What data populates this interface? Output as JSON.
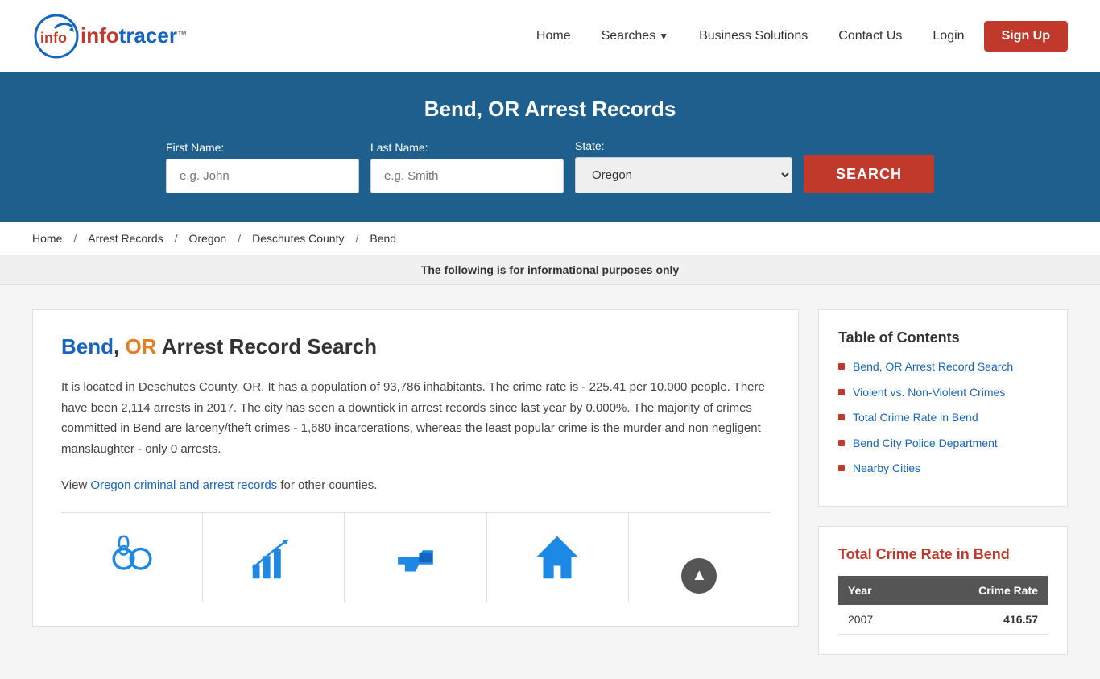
{
  "header": {
    "logo_text_red": "info",
    "logo_text_blue": "tracer",
    "logo_tm": "™",
    "nav": {
      "home": "Home",
      "searches": "Searches",
      "business_solutions": "Business Solutions",
      "contact_us": "Contact Us",
      "login": "Login",
      "signup": "Sign Up"
    }
  },
  "hero": {
    "title": "Bend, OR Arrest Records",
    "form": {
      "first_name_label": "First Name:",
      "first_name_placeholder": "e.g. John",
      "last_name_label": "Last Name:",
      "last_name_placeholder": "e.g. Smith",
      "state_label": "State:",
      "state_value": "Oregon",
      "search_button": "SEARCH"
    }
  },
  "breadcrumb": {
    "home": "Home",
    "arrest_records": "Arrest Records",
    "oregon": "Oregon",
    "deschutes_county": "Deschutes County",
    "bend": "Bend"
  },
  "info_bar": {
    "text": "The following is for informational purposes only"
  },
  "content": {
    "title_blue1": "Bend",
    "title_comma": ",",
    "title_orange": " OR",
    "title_rest": " Arrest Record Search",
    "body_text": "It is located in Deschutes County, OR. It has a population of 93,786 inhabitants. The crime rate is - 225.41 per 10.000 people. There have been 2,114 arrests in 2017. The city has seen a downtick in arrest records since last year by 0.000%. The majority of crimes committed in Bend are larceny/theft crimes - 1,680 incarcerations, whereas the least popular crime is the murder and non negligent manslaughter - only 0 arrests.",
    "view_text": "View ",
    "link_text": "Oregon criminal and arrest records",
    "view_end": " for other counties."
  },
  "sidebar": {
    "toc": {
      "title": "Table of Contents",
      "items": [
        {
          "label": "Bend, OR Arrest Record Search",
          "href": "#"
        },
        {
          "label": "Violent vs. Non-Violent Crimes",
          "href": "#"
        },
        {
          "label": "Total Crime Rate in Bend",
          "href": "#"
        },
        {
          "label": "Bend City Police Department",
          "href": "#"
        },
        {
          "label": "Nearby Cities",
          "href": "#"
        }
      ]
    },
    "crime": {
      "title": "Total Crime Rate in Bend",
      "table": {
        "col1": "Year",
        "col2": "Crime Rate",
        "rows": [
          {
            "year": "2007",
            "rate": "416.57"
          }
        ]
      }
    }
  }
}
